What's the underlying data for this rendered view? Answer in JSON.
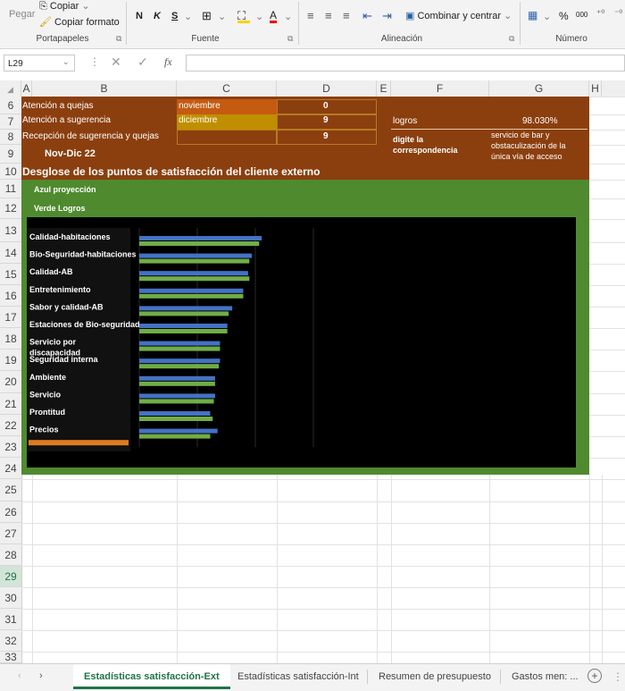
{
  "ribbon": {
    "paste_label": "Pegar",
    "copy_label": "Copiar",
    "copy_format_label": "Copiar formato",
    "group_clipboard": "Portapapeles",
    "bold": "N",
    "italic": "K",
    "underline": "S",
    "font_color_letter": "A",
    "group_font": "Fuente",
    "merge_center_label": "Combinar y centrar",
    "group_alignment": "Alineación",
    "percent": "%",
    "thousands": "000",
    "group_number": "Número"
  },
  "formula_bar": {
    "cell_ref": "L29",
    "fx": "fx",
    "value": ""
  },
  "columns": [
    "A",
    "B",
    "C",
    "D",
    "E",
    "F",
    "G",
    "H"
  ],
  "rows": [
    "6",
    "7",
    "8",
    "9",
    "10",
    "11",
    "12",
    "13",
    "14",
    "15",
    "16",
    "17",
    "18",
    "19",
    "20",
    "21",
    "22",
    "23",
    "24",
    "25",
    "26",
    "27",
    "28",
    "29",
    "30",
    "31",
    "32",
    "33"
  ],
  "selected_row": "29",
  "sheet": {
    "b6": "Atención a quejas",
    "b7": "Atención a sugerencia",
    "b8": "Recepción de sugerencia y quejas",
    "b9": "Nov-Dic 22",
    "b10": "Desglose de los puntos de satisfacción del cliente externo",
    "b11": "Azul proyección",
    "b12": "Verde Logros",
    "c6": "noviembre",
    "c7": "diciembre",
    "d6": "0",
    "d7": "9",
    "d8": "9",
    "f7": "logros",
    "g7": "98.030%",
    "f8": "digite la correspondencia",
    "g8": "servicio de bar y obstaculización de la única vía de acceso"
  },
  "colors": {
    "brown": "#8b3f0e",
    "green_bg": "#4f8a2f",
    "orange_cell": "#c55a11",
    "gold_cell": "#bf8f00",
    "series_blue": "#4472c4",
    "series_green": "#70ad47",
    "excel_green": "#217346"
  },
  "chart_data": {
    "type": "bar",
    "orientation": "horizontal",
    "categories": [
      "Calidad-habitaciones",
      "Bio-Seguridad-habitaciones",
      "Calidad-AB",
      "Entretenimiento",
      "Sabor y calidad-AB",
      "Estaciones de Bio-seguridad",
      "Servicio por discapacidad",
      "Seguridad interna",
      "Ambiente",
      "Servicio",
      "Prontitud",
      "Precios"
    ],
    "series": [
      {
        "color": "#4472c4",
        "values": [
          100,
          92,
          89,
          85,
          76,
          72,
          66,
          66,
          62,
          62,
          58,
          64
        ]
      },
      {
        "color": "#70ad47",
        "values": [
          98,
          90,
          90,
          85,
          73,
          72,
          66,
          65,
          62,
          61,
          60,
          58
        ]
      }
    ],
    "grid": true,
    "legend": "none"
  },
  "tabs": [
    "Estadísticas satisfacción-Ext",
    "Estadísticas satisfacción-Int",
    "Resumen de presupuesto",
    "Gastos men: ..."
  ],
  "active_tab": 0
}
